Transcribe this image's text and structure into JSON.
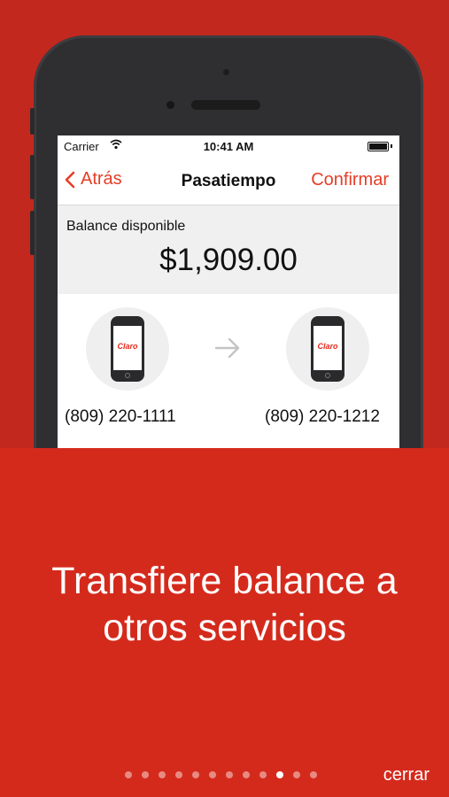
{
  "status_bar": {
    "carrier": "Carrier",
    "time": "10:41 AM"
  },
  "navbar": {
    "back_label": "Atrás",
    "title": "Pasatiempo",
    "confirm_label": "Confirmar"
  },
  "balance": {
    "label": "Balance disponible",
    "amount": "$1,909.00"
  },
  "transfer": {
    "from_number": "(809) 220-1111",
    "to_number": "(809) 220-1212",
    "device_logo": "Claro"
  },
  "slide": {
    "headline_line1": "Transfiere balance a",
    "headline_line2": "otros servicios",
    "page_count": 12,
    "active_page_index": 9
  },
  "footer": {
    "close_label": "cerrar"
  },
  "colors": {
    "accent": "#e53d26",
    "brand_red": "#d42a1c",
    "background_top": "#c3281f"
  }
}
